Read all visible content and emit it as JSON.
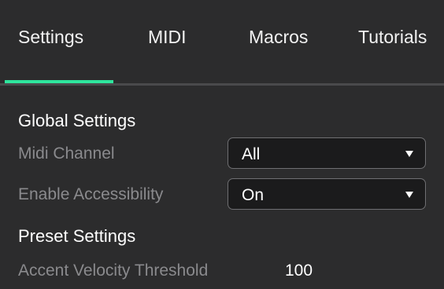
{
  "accent_color": "#2ee59d",
  "tabs": [
    {
      "label": "Settings",
      "active": true
    },
    {
      "label": "MIDI",
      "active": false
    },
    {
      "label": "Macros",
      "active": false
    },
    {
      "label": "Tutorials",
      "active": false
    }
  ],
  "global_settings": {
    "title": "Global Settings",
    "midi_channel": {
      "label": "Midi Channel",
      "value": "All",
      "icon": "chevron-down-icon"
    },
    "enable_accessibility": {
      "label": "Enable Accessibility",
      "value": "On",
      "icon": "chevron-down-icon"
    }
  },
  "preset_settings": {
    "title": "Preset Settings",
    "accent_velocity_threshold": {
      "label": "Accent Velocity Threshold",
      "value": "100"
    }
  }
}
